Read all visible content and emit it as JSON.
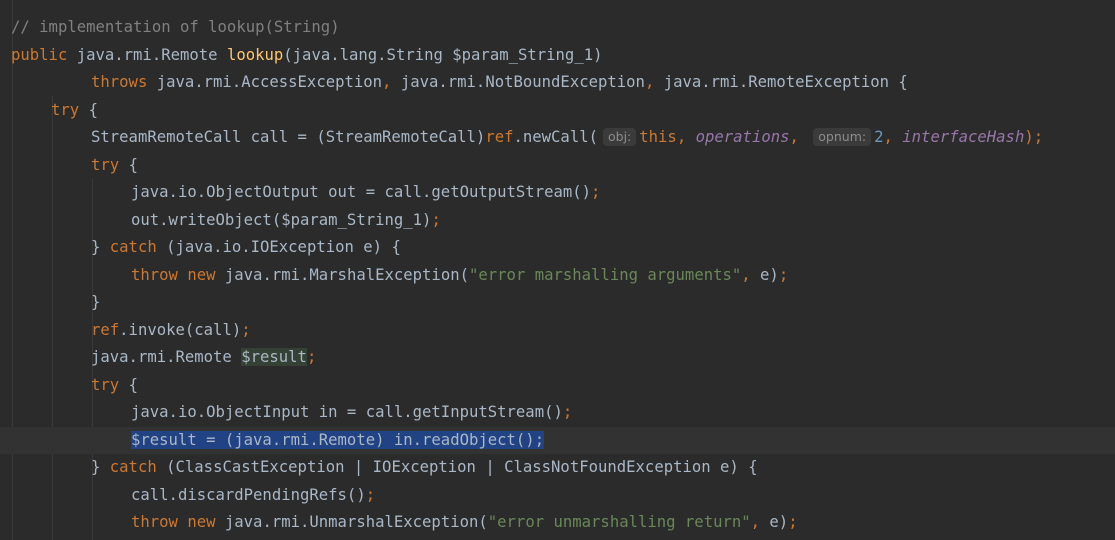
{
  "code": {
    "lines": [
      {
        "indent": 0,
        "tokens": [
          {
            "t": "// implementation of lookup(String)",
            "c": "cm"
          }
        ]
      },
      {
        "indent": 0,
        "tokens": [
          {
            "t": "public ",
            "c": "kw"
          },
          {
            "t": "java.rmi.Remote ",
            "c": "pl"
          },
          {
            "t": "lookup",
            "c": "fn"
          },
          {
            "t": "(java.lang.String $param_String_1)",
            "c": "pl"
          }
        ]
      },
      {
        "indent": 2,
        "tokens": [
          {
            "t": "throws ",
            "c": "kw"
          },
          {
            "t": "java.rmi.AccessException",
            "c": "pl"
          },
          {
            "t": ", ",
            "c": "kw"
          },
          {
            "t": "java.rmi.NotBoundException",
            "c": "pl"
          },
          {
            "t": ", ",
            "c": "kw"
          },
          {
            "t": "java.rmi.RemoteException {",
            "c": "pl"
          }
        ]
      },
      {
        "indent": 1,
        "tokens": [
          {
            "t": "try ",
            "c": "kw"
          },
          {
            "t": "{",
            "c": "pl"
          }
        ]
      },
      {
        "indent": 2,
        "tokens": [
          {
            "t": "StreamRemoteCall call = (StreamRemoteCall)",
            "c": "pl"
          },
          {
            "t": "ref",
            "c": "kw"
          },
          {
            "t": ".newCall(",
            "c": "pl"
          },
          {
            "t": "obj:",
            "c": "hint"
          },
          {
            "t": "this",
            "c": "kw"
          },
          {
            "t": ", ",
            "c": "kw"
          },
          {
            "t": "operations",
            "c": "fld"
          },
          {
            "t": ", ",
            "c": "kw"
          },
          {
            "t": "opnum:",
            "c": "hint"
          },
          {
            "t": "2",
            "c": "num"
          },
          {
            "t": ", ",
            "c": "kw"
          },
          {
            "t": "interfaceHash",
            "c": "fld"
          },
          {
            "t": ");",
            "c": "kw"
          }
        ]
      },
      {
        "indent": 2,
        "tokens": [
          {
            "t": "try ",
            "c": "kw"
          },
          {
            "t": "{",
            "c": "pl"
          }
        ]
      },
      {
        "indent": 3,
        "tokens": [
          {
            "t": "java.io.ObjectOutput out = call.getOutputStream()",
            "c": "pl"
          },
          {
            "t": ";",
            "c": "kw"
          }
        ]
      },
      {
        "indent": 3,
        "tokens": [
          {
            "t": "out.writeObject($param_String_1)",
            "c": "pl"
          },
          {
            "t": ";",
            "c": "kw"
          }
        ]
      },
      {
        "indent": 2,
        "tokens": [
          {
            "t": "} ",
            "c": "pl"
          },
          {
            "t": "catch ",
            "c": "kw"
          },
          {
            "t": "(java.io.IOException e) {",
            "c": "pl"
          }
        ]
      },
      {
        "indent": 3,
        "tokens": [
          {
            "t": "throw new ",
            "c": "kw"
          },
          {
            "t": "java.rmi.MarshalException(",
            "c": "pl"
          },
          {
            "t": "\"error marshalling arguments\"",
            "c": "str"
          },
          {
            "t": ", ",
            "c": "kw"
          },
          {
            "t": "e)",
            "c": "pl"
          },
          {
            "t": ";",
            "c": "kw"
          }
        ]
      },
      {
        "indent": 2,
        "tokens": [
          {
            "t": "}",
            "c": "pl"
          }
        ]
      },
      {
        "indent": 2,
        "tokens": [
          {
            "t": "ref",
            "c": "kw"
          },
          {
            "t": ".invoke(call)",
            "c": "pl"
          },
          {
            "t": ";",
            "c": "kw"
          }
        ]
      },
      {
        "indent": 2,
        "tokens": [
          {
            "t": "java.rmi.Remote ",
            "c": "pl"
          },
          {
            "t": "$result",
            "c": "hl"
          },
          {
            "t": ";",
            "c": "kw"
          }
        ]
      },
      {
        "indent": 2,
        "tokens": [
          {
            "t": "try ",
            "c": "kw"
          },
          {
            "t": "{",
            "c": "pl"
          }
        ]
      },
      {
        "indent": 3,
        "tokens": [
          {
            "t": "java.io.ObjectInput in = call.getInputStream()",
            "c": "pl"
          },
          {
            "t": ";",
            "c": "kw"
          }
        ]
      },
      {
        "indent": 3,
        "current": true,
        "tokens": [
          {
            "t": "$result = (java.rmi.Remote) in.readObject();",
            "c": "sel"
          }
        ]
      },
      {
        "indent": 2,
        "tokens": [
          {
            "t": "} ",
            "c": "pl"
          },
          {
            "t": "catch ",
            "c": "kw"
          },
          {
            "t": "(ClassCastException | IOException | ClassNotFoundException e) {",
            "c": "pl"
          }
        ]
      },
      {
        "indent": 3,
        "tokens": [
          {
            "t": "call.discardPendingRefs()",
            "c": "pl"
          },
          {
            "t": ";",
            "c": "kw"
          }
        ]
      },
      {
        "indent": 3,
        "tokens": [
          {
            "t": "throw new ",
            "c": "kw"
          },
          {
            "t": "java.rmi.UnmarshalException(",
            "c": "pl"
          },
          {
            "t": "\"error unmarshalling return\"",
            "c": "str"
          },
          {
            "t": ", ",
            "c": "kw"
          },
          {
            "t": "e)",
            "c": "pl"
          },
          {
            "t": ";",
            "c": "kw"
          }
        ]
      }
    ]
  }
}
